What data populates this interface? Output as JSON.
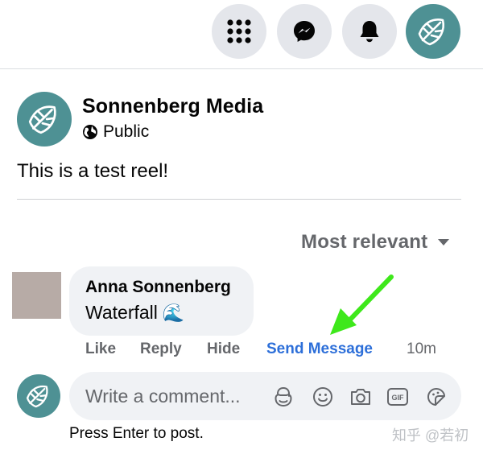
{
  "topbar": {
    "icons": [
      "menu-grid-icon",
      "messenger-icon",
      "bell-icon",
      "profile-logo-icon"
    ]
  },
  "post": {
    "author": "Sonnenberg Media",
    "privacy": "Public",
    "text": "This is a test reel!"
  },
  "comments": {
    "sort_label": "Most relevant",
    "items": [
      {
        "author": "Anna Sonnenberg",
        "text": "Waterfall",
        "emoji": "🌊",
        "actions": {
          "like": "Like",
          "reply": "Reply",
          "hide": "Hide",
          "send_message": "Send Message",
          "time": "10m"
        }
      }
    ]
  },
  "composer": {
    "placeholder": "Write a comment...",
    "hint": "Press Enter to post."
  },
  "watermark": "知乎 @若初",
  "colors": {
    "brand_teal": "#4e9194",
    "link_blue": "#2d6fd9",
    "annotation_arrow": "#3ee81b",
    "secondary_text": "#65676b",
    "bubble_bg": "#f0f2f5"
  }
}
